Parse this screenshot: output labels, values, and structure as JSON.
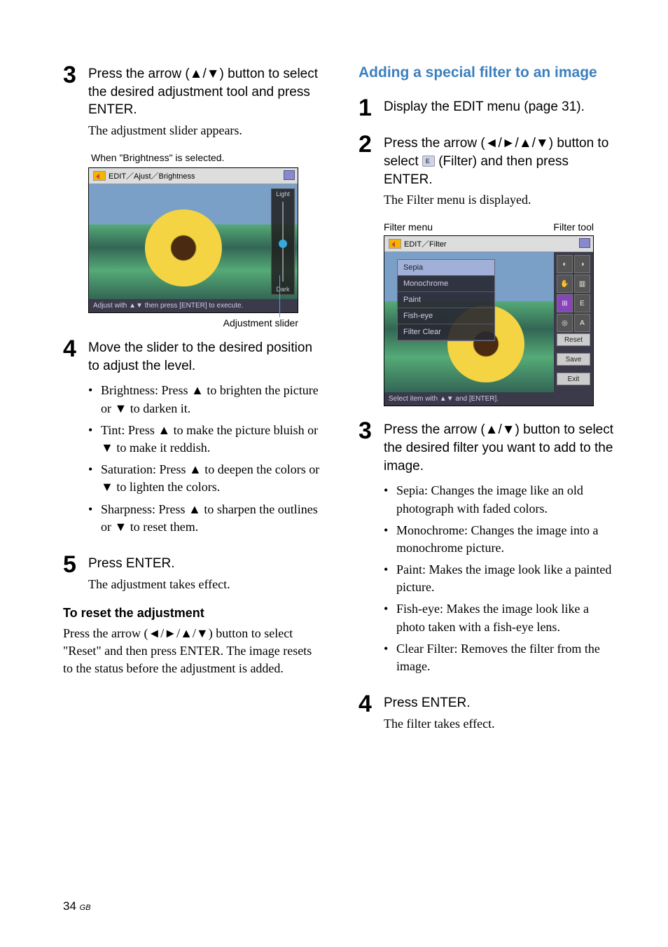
{
  "left": {
    "step3": {
      "num": "3",
      "instr": "Press the arrow (▲/▼) button to select the desired adjustment tool and press ENTER.",
      "result": "The adjustment slider appears.",
      "caption": "When \"Brightness\" is selected.",
      "mock": {
        "titlebar": "EDIT／Ajust／Brightness",
        "light": "Light",
        "dark": "Dark",
        "footer": "Adjust with ▲▼ then press [ENTER] to execute."
      },
      "slider_caption": "Adjustment slider"
    },
    "step4": {
      "num": "4",
      "instr": "Move the slider to the desired position to adjust the level.",
      "bullets": [
        "Brightness: Press ▲ to brighten the picture or ▼ to darken it.",
        "Tint: Press ▲ to make the picture bluish or ▼ to make it reddish.",
        "Saturation: Press ▲ to deepen the colors or ▼ to lighten the colors.",
        "Sharpness:  Press ▲ to sharpen the outlines or ▼ to reset them."
      ]
    },
    "step5": {
      "num": "5",
      "instr": "Press ENTER.",
      "result": "The adjustment takes effect."
    },
    "reset_head": "To reset the adjustment",
    "reset_body": "Press the arrow (◄/►/▲/▼) button to select \"Reset\" and then press ENTER. The image resets to the status before the adjustment is added."
  },
  "right": {
    "heading": "Adding a special filter to an image",
    "step1": {
      "num": "1",
      "instr": "Display the EDIT menu (page 31)."
    },
    "step2": {
      "num": "2",
      "instr_pre": "Press the arrow (◄/►/▲/▼) button to select ",
      "instr_post": " (Filter) and then press ENTER.",
      "result": "The Filter menu is displayed.",
      "caption_left": "Filter menu",
      "caption_right": "Filter tool",
      "mock": {
        "titlebar": "EDIT／Filter",
        "menu": [
          "Sepia",
          "Monochrome",
          "Paint",
          "Fish-eye",
          "Filter Clear"
        ],
        "tools": [
          "◐",
          "◑",
          "✋",
          "▥",
          "⊞",
          "E",
          "◎",
          "A"
        ],
        "btns": [
          "Reset",
          "Save",
          "Exit"
        ],
        "footer": "Select item with ▲▼ and [ENTER]."
      }
    },
    "step3": {
      "num": "3",
      "instr": "Press the arrow (▲/▼) button to select the desired filter you want to add to the image.",
      "bullets": [
        "Sepia: Changes the image like an old photograph with faded colors.",
        "Monochrome: Changes the image into a monochrome picture.",
        "Paint: Makes the image look like a painted picture.",
        "Fish-eye: Makes the image look like a photo taken with a fish-eye lens.",
        "Clear Filter: Removes the filter from the image."
      ]
    },
    "step4": {
      "num": "4",
      "instr": "Press ENTER.",
      "result": "The filter takes effect."
    }
  },
  "page": {
    "num": "34",
    "suffix": "GB"
  }
}
